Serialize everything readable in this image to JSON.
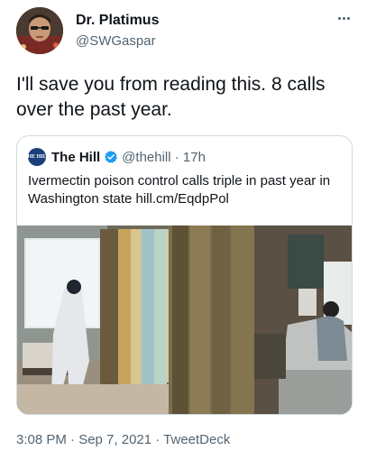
{
  "author": {
    "display_name": "Dr. Platimus",
    "handle": "@SWGaspar",
    "avatar_icon": "user-avatar"
  },
  "more_icon": "more-options-icon",
  "tweet": {
    "text": "I'll save you from reading this. 8 calls over the past year."
  },
  "quoted_tweet": {
    "logo_text": "THE HILL",
    "name": "The Hill",
    "verified_icon": "verified-badge-icon",
    "handle_time": "@thehill · 17h",
    "text": "Ivermectin poison control calls triple in past year in Washington state hill.cm/EqdpPol",
    "verified_color": "#1d9bf0"
  },
  "footer": {
    "meta": "3:08 PM · Sep 7, 2021 · TweetDeck"
  }
}
